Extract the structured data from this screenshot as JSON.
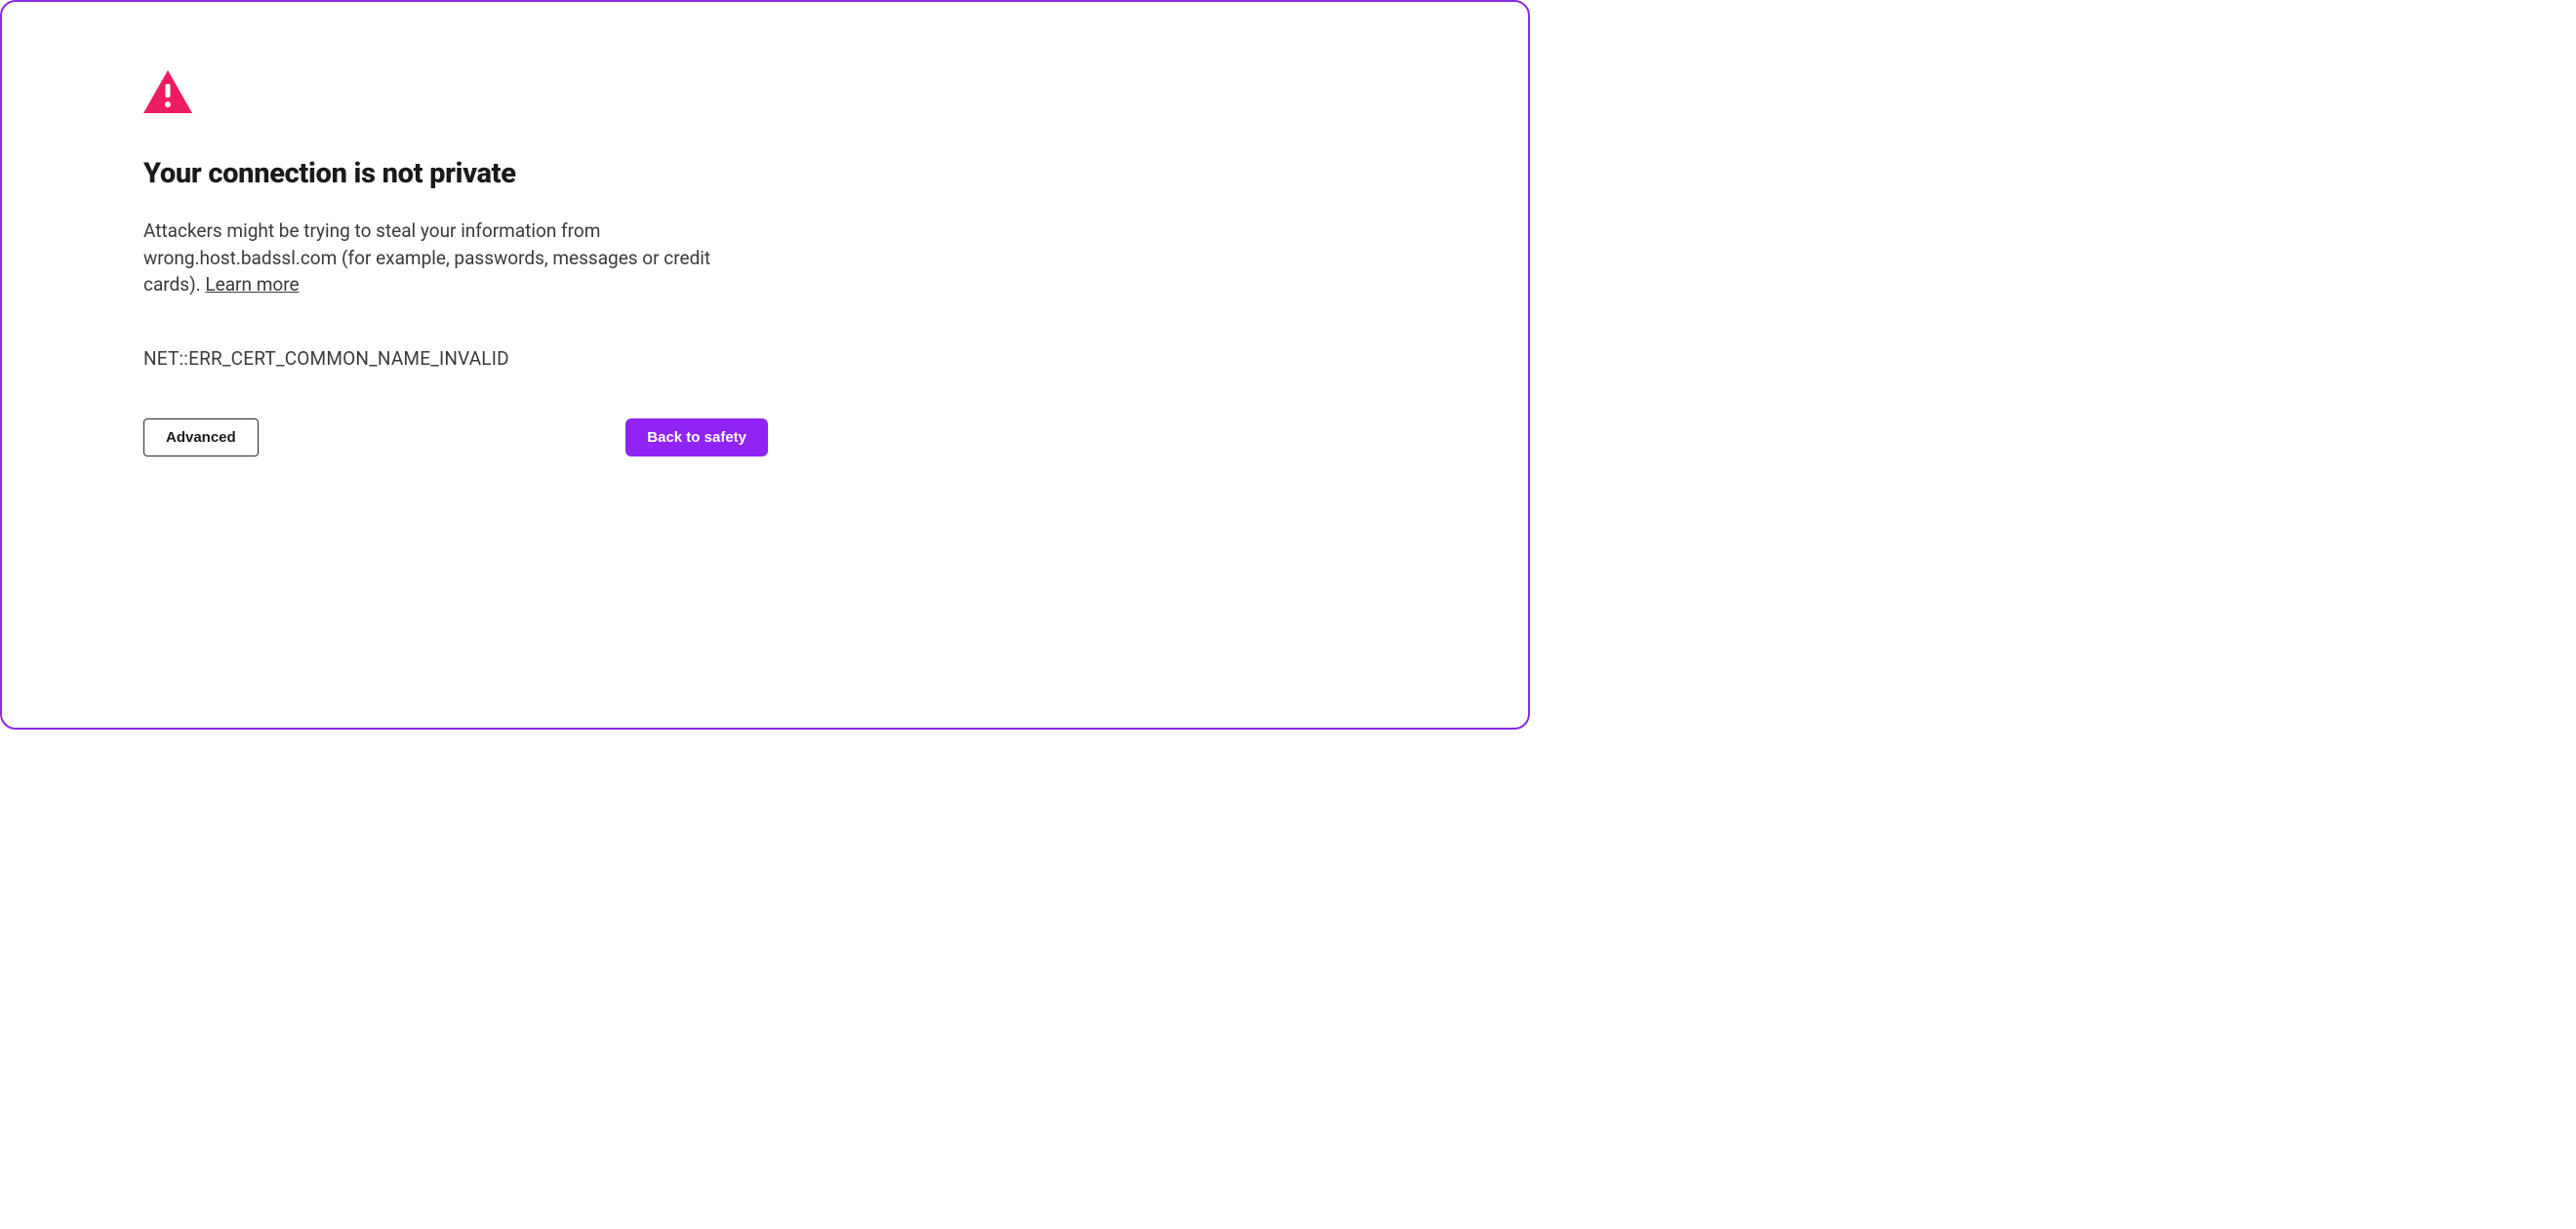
{
  "warning": {
    "icon_color": "#ed1d61",
    "title": "Your connection is not private",
    "description_prefix": "Attackers might be trying to steal your information from wrong.host.badssl.com (for example, passwords, messages or credit cards). ",
    "learn_more_label": "Learn more",
    "error_code": "NET::ERR_CERT_COMMON_NAME_INVALID"
  },
  "buttons": {
    "advanced_label": "Advanced",
    "back_to_safety_label": "Back to safety"
  },
  "colors": {
    "accent": "#8f24f5",
    "border": "#8a2be2",
    "danger": "#ed1d61"
  }
}
